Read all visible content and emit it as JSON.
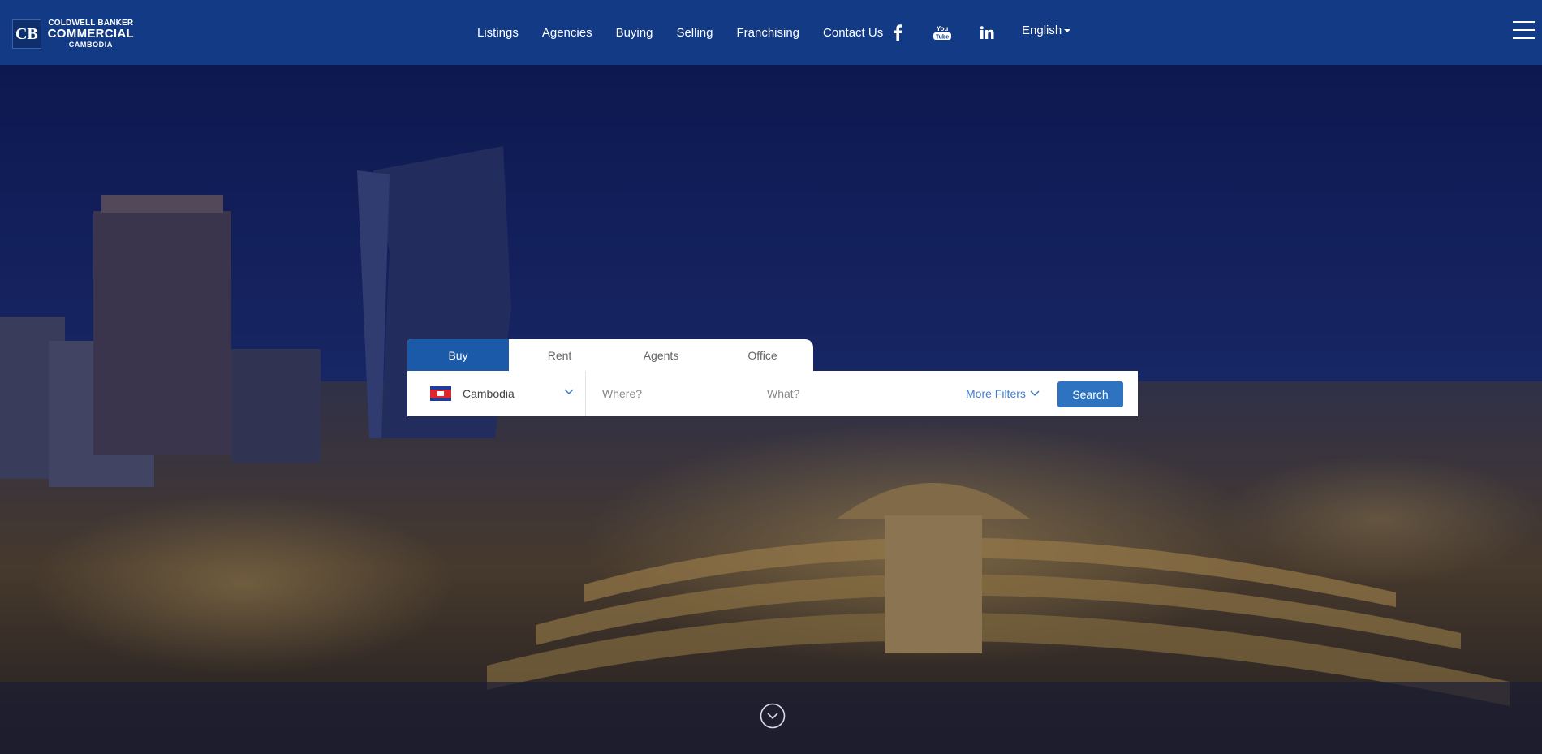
{
  "header": {
    "logo": {
      "mark": "CB",
      "line1": "COLDWELL BANKER",
      "line2": "COMMERCIAL",
      "line3": "CAMBODIA"
    },
    "nav": [
      "Listings",
      "Agencies",
      "Buying",
      "Selling",
      "Franchising",
      "Contact Us"
    ],
    "social": [
      "facebook-icon",
      "youtube-icon",
      "linkedin-icon"
    ],
    "language": "English",
    "colors": {
      "background": "#133a85",
      "text": "#ffffff"
    }
  },
  "search": {
    "tabs": [
      "Buy",
      "Rent",
      "Agents",
      "Office"
    ],
    "active_tab": "Buy",
    "country": "Cambodia",
    "where_placeholder": "Where?",
    "what_placeholder": "What?",
    "more_filters": "More Filters",
    "search_button": "Search",
    "colors": {
      "active_tab": "#1b5aa8",
      "button": "#2d73bf",
      "filters_link": "#3d7cc9"
    }
  },
  "hero": {
    "background": "night cityscape photo",
    "scroll_icon": "chevron-down-circle-icon"
  }
}
